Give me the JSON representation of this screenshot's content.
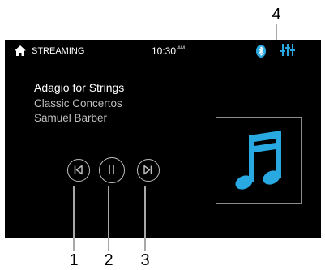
{
  "status_bar": {
    "home_icon": "home-icon",
    "source_label": "STREAMING",
    "time": "10:30",
    "ampm": "AM",
    "bluetooth_icon": "bluetooth-icon",
    "equalizer_icon": "equalizer-icon"
  },
  "now_playing": {
    "title": "Adagio for Strings",
    "album": "Classic Concertos",
    "artist": "Samuel Barber"
  },
  "controls": {
    "previous_icon": "skip-previous-icon",
    "pause_icon": "pause-icon",
    "next_icon": "skip-next-icon"
  },
  "album_art": {
    "icon": "music-note-icon"
  },
  "callouts": [
    "1",
    "2",
    "3",
    "4"
  ],
  "colors": {
    "accent": "#29a9e1",
    "screen_bg": "#000000",
    "text_primary": "#ffffff",
    "text_secondary": "#bfbfbf",
    "control_outline": "#bdbdbd",
    "callout_line": "#a8a8a8"
  }
}
